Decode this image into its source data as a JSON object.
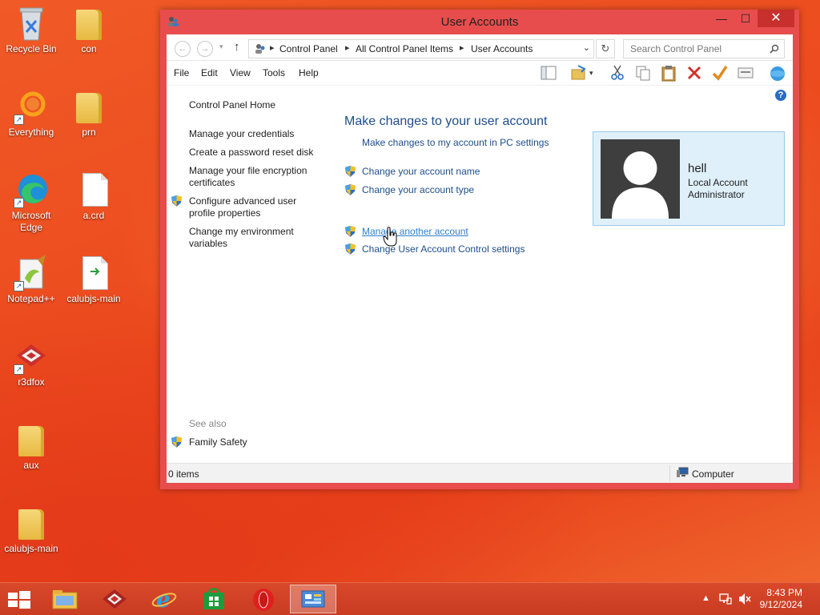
{
  "desktop": {
    "icons": [
      {
        "label": "Recycle Bin"
      },
      {
        "label": "con"
      },
      {
        "label": "Everything"
      },
      {
        "label": "prn"
      },
      {
        "label": "Microsoft Edge"
      },
      {
        "label": "a.crd"
      },
      {
        "label": "Notepad++"
      },
      {
        "label": "calubjs-main"
      },
      {
        "label": "r3dfox"
      },
      {
        "label": "aux"
      },
      {
        "label": "calubjs-main"
      }
    ]
  },
  "window": {
    "title": "User Accounts",
    "minimize_glyph": "—",
    "maximize_glyph": "☐",
    "close_glyph": "✕",
    "address": {
      "crumbs": [
        "Control Panel",
        "All Control Panel Items",
        "User Accounts"
      ]
    },
    "search": {
      "placeholder": "Search Control Panel"
    },
    "menu": [
      "File",
      "Edit",
      "View",
      "Tools",
      "Help"
    ],
    "left_pane": {
      "home": "Control Panel Home",
      "links": [
        "Manage your credentials",
        "Create a password reset disk",
        "Manage your file encryption certificates",
        "Configure advanced user profile properties",
        "Change my environment variables"
      ],
      "see_also": "See also",
      "family_safety": "Family Safety"
    },
    "main": {
      "heading": "Make changes to your user account",
      "links": [
        "Make changes to my account in PC settings",
        "Change your account name",
        "Change your account type",
        "Manage another account",
        "Change User Account Control settings"
      ]
    },
    "user": {
      "name": "hell",
      "line1": "Local Account",
      "line2": "Administrator"
    },
    "status": {
      "items": "0 items",
      "computer": "Computer"
    },
    "help_glyph": "?"
  },
  "taskbar": {
    "time": "8:43 PM",
    "date": "9/12/2024"
  },
  "colors": {
    "link": "#1e4d8a",
    "window_frame": "#e84d4d",
    "user_card_bg": "#dff0fa"
  }
}
